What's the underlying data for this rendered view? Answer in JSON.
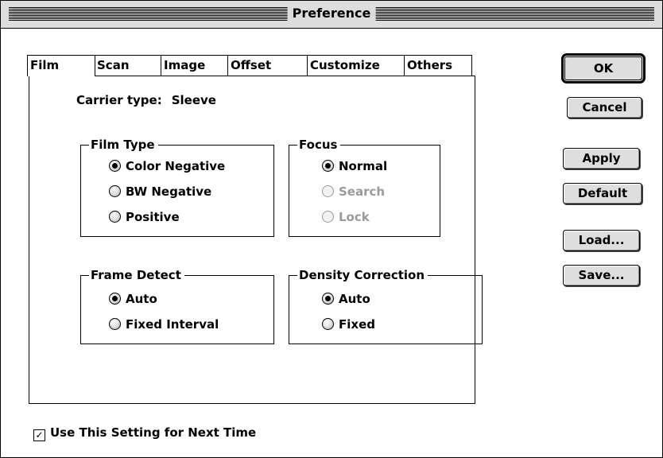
{
  "window": {
    "title": "Preference"
  },
  "tabs": [
    {
      "label": "Film",
      "active": true
    },
    {
      "label": "Scan"
    },
    {
      "label": "Image"
    },
    {
      "label": "Offset"
    },
    {
      "label": "Customize"
    },
    {
      "label": "Others"
    }
  ],
  "carrier": {
    "label": "Carrier type:",
    "value": "Sleeve"
  },
  "film_type": {
    "legend": "Film Type",
    "options": [
      {
        "label": "Color Negative",
        "selected": true
      },
      {
        "label": "BW Negative"
      },
      {
        "label": "Positive"
      }
    ]
  },
  "focus": {
    "legend": "Focus",
    "options": [
      {
        "label": "Normal",
        "selected": true
      },
      {
        "label": "Search",
        "disabled": true
      },
      {
        "label": "Lock",
        "disabled": true
      }
    ]
  },
  "frame_detect": {
    "legend": "Frame Detect",
    "options": [
      {
        "label": "Auto",
        "selected": true
      },
      {
        "label": "Fixed Interval"
      }
    ]
  },
  "density_correction": {
    "legend": "Density Correction",
    "options": [
      {
        "label": "Auto",
        "selected": true
      },
      {
        "label": "Fixed"
      }
    ]
  },
  "buttons": {
    "ok": "OK",
    "cancel": "Cancel",
    "apply": "Apply",
    "default": "Default",
    "load": "Load...",
    "save": "Save..."
  },
  "footer": {
    "checkbox_label": "Use This Setting for Next Time",
    "checked": true
  }
}
